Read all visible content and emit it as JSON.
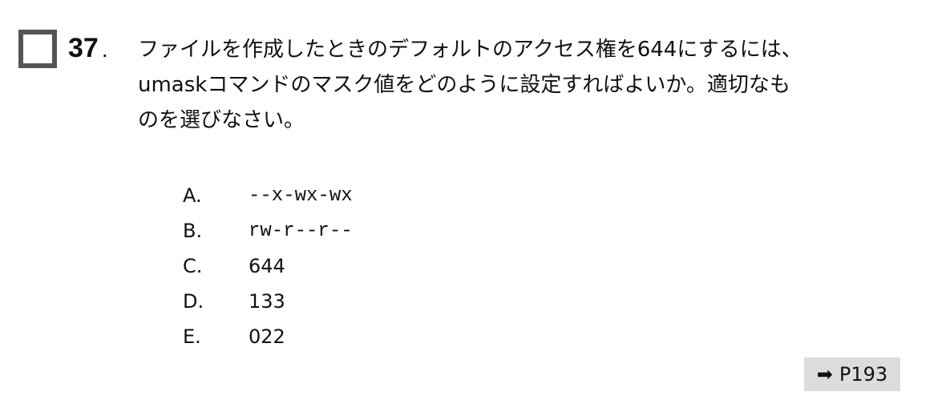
{
  "question": {
    "number": "37",
    "number_suffix": ".",
    "text_lines": [
      "ファイルを作成したときのデフォルトのアクセス権を644にするには、",
      "umaskコマンドのマスク値をどのように設定すればよいか。適切なも",
      "のを選びなさい。"
    ]
  },
  "options": [
    {
      "label": "A.",
      "value": "--x-wx-wx"
    },
    {
      "label": "B.",
      "value": "rw-r--r--"
    },
    {
      "label": "C.",
      "value": "644"
    },
    {
      "label": "D.",
      "value": "133"
    },
    {
      "label": "E.",
      "value": "022"
    }
  ],
  "reference": {
    "icon": "arrow-right-icon",
    "arrow": "➡",
    "page": "P193"
  }
}
